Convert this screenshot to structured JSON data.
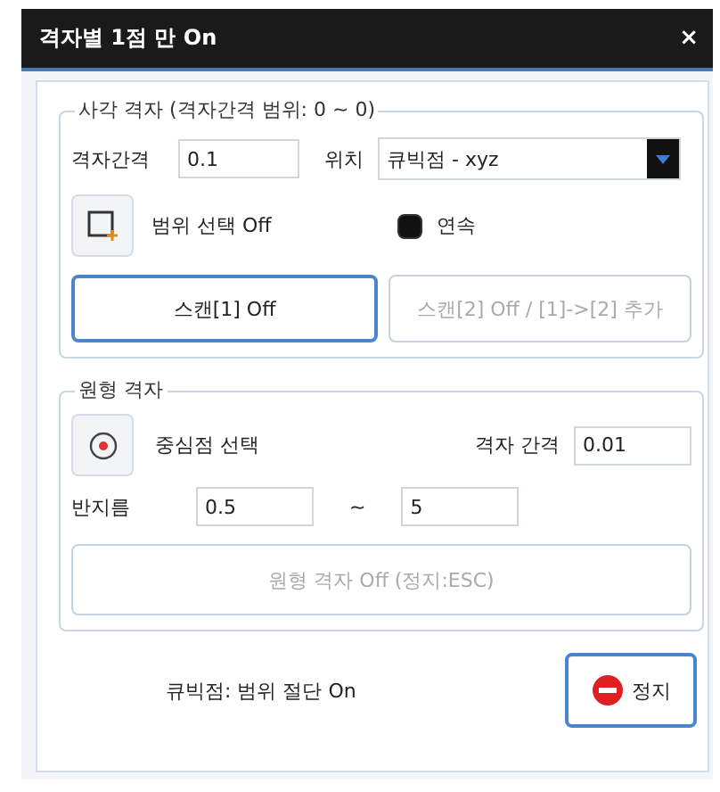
{
  "window": {
    "title": "격자별 1점 만 On",
    "close": "×"
  },
  "rect_grid": {
    "legend": "사각 격자 (격자간격 범위: 0 ~ 0)",
    "spacing": {
      "label": "격자간격",
      "value": "0.1"
    },
    "position": {
      "label": "위치",
      "value": "큐빅점 - xyz"
    },
    "range_select": {
      "label": "범위 선택 Off"
    },
    "continuous": {
      "label": "연속",
      "checked": true
    },
    "buttons": [
      {
        "label": "스캔[1] Off",
        "disabled": false,
        "focused": true
      },
      {
        "label": "스캔[2] Off / [1]->[2] 추가",
        "disabled": true,
        "focused": false
      }
    ]
  },
  "circle_grid": {
    "legend": "원형 격자",
    "center_select": {
      "label": "중심점 선택"
    },
    "spacing": {
      "label": "격자 간격",
      "value": "0.01"
    },
    "radius": {
      "label": "반지름",
      "from": "0.5",
      "separator": "~",
      "to": "5"
    },
    "button": {
      "label": "원형 격자 Off (정지:ESC)",
      "disabled": true
    }
  },
  "status": "큐빅점: 범위 절단 On",
  "stop_button": {
    "label": "정지"
  }
}
